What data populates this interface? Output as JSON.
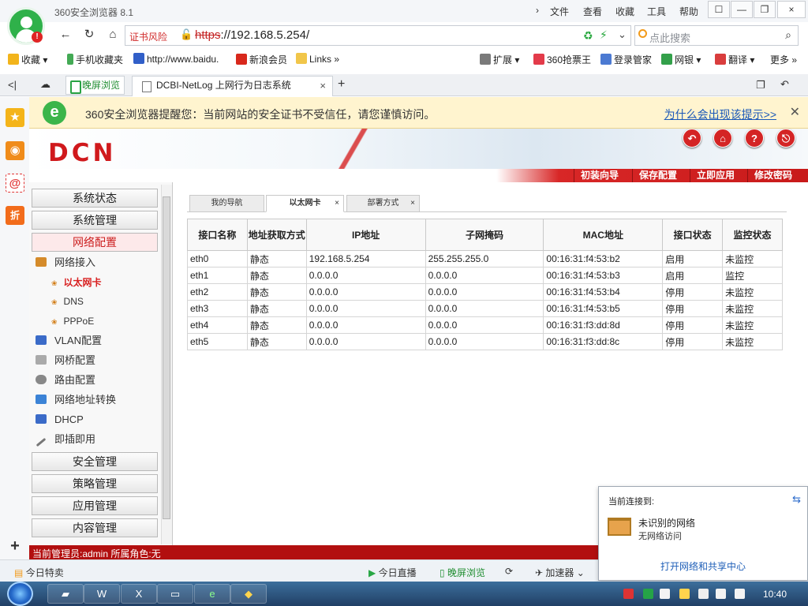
{
  "browser": {
    "title": "360安全浏览器 8.1",
    "menus": [
      "文件",
      "查看",
      "收藏",
      "工具",
      "帮助"
    ],
    "menu_chevron": "›",
    "window_buttons": [
      "☐",
      "—",
      "❐",
      "×"
    ],
    "cert_warning": "证书风险",
    "address": {
      "scheme": "https",
      "rest": "://192.168.5.254/"
    },
    "search_placeholder": "点此搜索",
    "nav_icons": {
      "back": "←",
      "refresh": "↻",
      "home": "⌂"
    },
    "bookmarks": [
      "收藏",
      "手机收藏夹",
      "http://www.baidu.",
      "新浪会员",
      "Links",
      "扩展",
      "360抢票王",
      "登录管家",
      "网银",
      "翻译",
      "更多"
    ],
    "tabs": {
      "green_tab": "晚屏浏览",
      "active_tab": "DCBI-NetLog 上网行为日志系统"
    },
    "notice": {
      "text": "360安全浏览器提醒您：当前网站的安全证书不受信任，请您谨慎访问。",
      "link": "为什么会出现该提示>>"
    }
  },
  "app": {
    "logo": "DCN",
    "header_actions": [
      "初装向导",
      "保存配置",
      "立即应用",
      "修改密码"
    ],
    "sidebar": {
      "top_categories": [
        "系统状态",
        "系统管理",
        "网络配置"
      ],
      "network_sub": {
        "label": "网络接入",
        "items": [
          "以太网卡",
          "DNS",
          "PPPoE"
        ]
      },
      "other_subs": [
        "VLAN配置",
        "网桥配置",
        "路由配置",
        "网络地址转换",
        "DHCP",
        "即插即用"
      ],
      "bottom_categories": [
        "安全管理",
        "策略管理",
        "应用管理",
        "内容管理"
      ]
    },
    "content_tabs": [
      "我的导航",
      "以太网卡",
      "部署方式"
    ],
    "table": {
      "headers": [
        "接口名称",
        "地址获取方式",
        "IP地址",
        "子网掩码",
        "MAC地址",
        "接口状态",
        "监控状态"
      ],
      "rows": [
        [
          "eth0",
          "静态",
          "192.168.5.254",
          "255.255.255.0",
          "00:16:31:f4:53:b2",
          "启用",
          "未监控"
        ],
        [
          "eth1",
          "静态",
          "0.0.0.0",
          "0.0.0.0",
          "00:16:31:f4:53:b3",
          "启用",
          "监控"
        ],
        [
          "eth2",
          "静态",
          "0.0.0.0",
          "0.0.0.0",
          "00:16:31:f4:53:b4",
          "停用",
          "未监控"
        ],
        [
          "eth3",
          "静态",
          "0.0.0.0",
          "0.0.0.0",
          "00:16:31:f4:53:b5",
          "停用",
          "未监控"
        ],
        [
          "eth4",
          "静态",
          "0.0.0.0",
          "0.0.0.0",
          "00:16:31:f3:dd:8d",
          "停用",
          "未监控"
        ],
        [
          "eth5",
          "静态",
          "0.0.0.0",
          "0.0.0.0",
          "00:16:31:f3:dd:8c",
          "停用",
          "未监控"
        ]
      ]
    },
    "status": "当前管理员:admin  所属角色:无"
  },
  "bottom_bar": [
    "今日特卖",
    "今日直播",
    "晚屏浏览",
    "加速器"
  ],
  "network_popup": {
    "title": "当前连接到:",
    "network": "未识别的网络",
    "status": "无网络访问",
    "link": "打开网络和共享中心"
  },
  "taskbar": {
    "time": "10:40"
  }
}
